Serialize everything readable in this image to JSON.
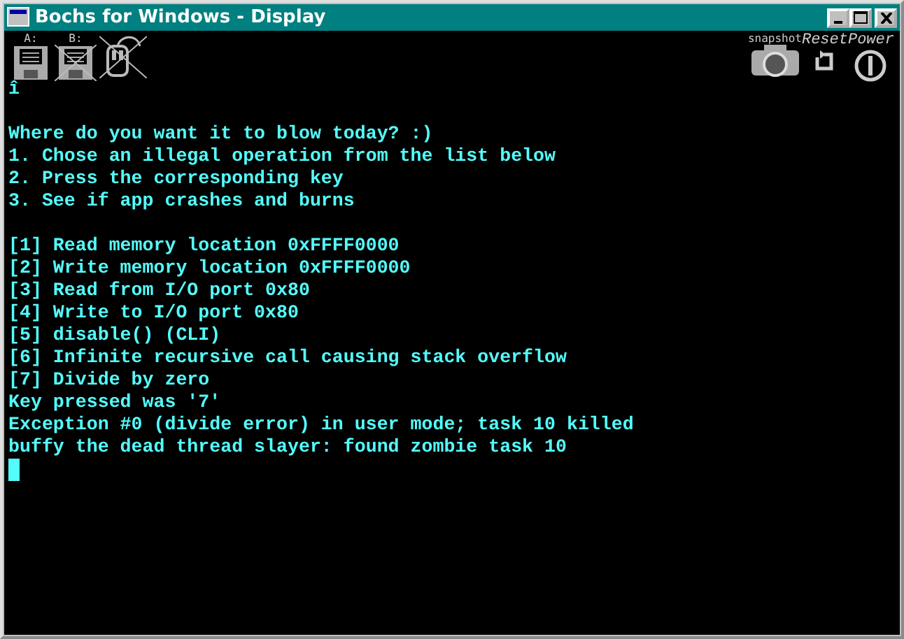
{
  "window": {
    "title": "Bochs for Windows - Display",
    "controls": [
      {
        "kind": "minimize"
      },
      {
        "kind": "maximize"
      },
      {
        "kind": "close"
      }
    ]
  },
  "toolbar": [
    {
      "kind": "floppy",
      "label": "A:",
      "disabled": false
    },
    {
      "kind": "floppy",
      "label": "B:",
      "disabled": true
    },
    {
      "kind": "mouse",
      "disabled": true
    },
    {
      "kind": "snapshot",
      "label": "snapshot"
    },
    {
      "kind": "reset",
      "label": "Reset"
    },
    {
      "kind": "power",
      "label": "Power"
    }
  ],
  "console": {
    "blocks": [
      [
        "î"
      ],
      [
        "Where do you want it to blow today? :)",
        "1. Chose an illegal operation from the list below",
        "2. Press the corresponding key",
        "3. See if app crashes and burns"
      ],
      [
        "[1] Read memory location 0xFFFF0000",
        "[2] Write memory location 0xFFFF0000",
        "[3] Read from I/O port 0x80",
        "[4] Write to I/O port 0x80",
        "[5] disable() (CLI)",
        "[6] Infinite recursive call causing stack overflow",
        "[7] Divide by zero",
        "Key pressed was '7'",
        "Exception #0 (divide error) in user mode; task 10 killed",
        "buffy the dead thread slayer: found zombie task 10"
      ]
    ],
    "cursor": true
  }
}
